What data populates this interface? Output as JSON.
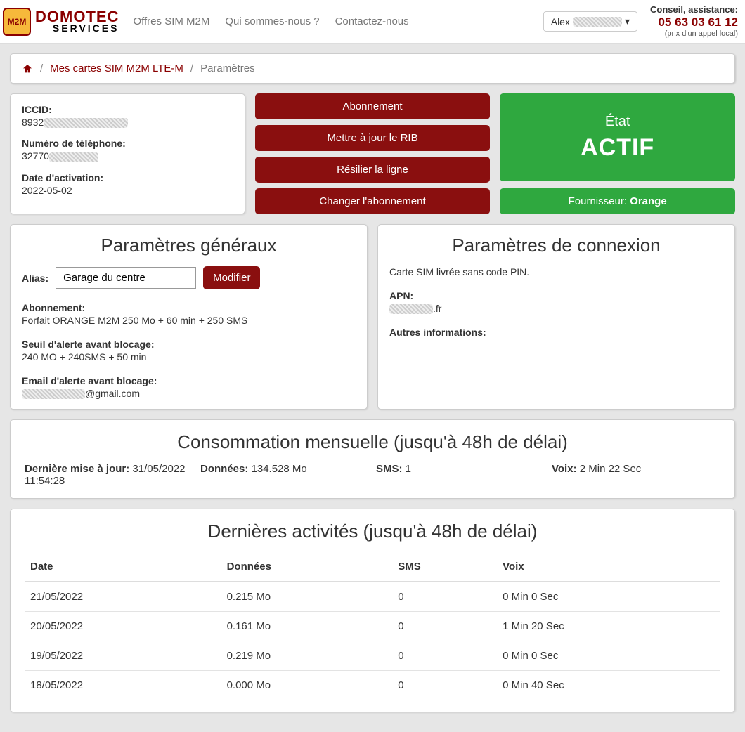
{
  "topbar": {
    "logo_chip": "M2M",
    "logo_line1": "DOMOTEC",
    "logo_line2": "SERVICES",
    "nav": [
      "Offres SIM M2M",
      "Qui sommes-nous ?",
      "Contactez-nous"
    ],
    "user_prefix": "Alex",
    "contact_l1": "Conseil, assistance:",
    "contact_l2": "05 63 03 61 12",
    "contact_l3": "(prix d'un appel local)"
  },
  "breadcrumb": {
    "link1": "Mes cartes SIM M2M LTE-M",
    "current": "Paramètres"
  },
  "info": {
    "iccid_label": "ICCID:",
    "iccid_value": "8932",
    "phone_label": "Numéro de téléphone:",
    "phone_value": "32770",
    "activation_label": "Date d'activation:",
    "activation_value": "2022-05-02"
  },
  "actions": {
    "b1": "Abonnement",
    "b2": "Mettre à jour le RIB",
    "b3": "Résilier la ligne",
    "b4": "Changer l'abonnement"
  },
  "state": {
    "title": "État",
    "value": "ACTIF",
    "provider_label": "Fournisseur: ",
    "provider_value": "Orange"
  },
  "general": {
    "title": "Paramètres généraux",
    "alias_label": "Alias:",
    "alias_value": "Garage du centre",
    "alias_btn": "Modifier",
    "subscription_label": "Abonnement:",
    "subscription_value": "Forfait ORANGE M2M 250 Mo + 60 min + 250 SMS",
    "threshold_label": "Seuil d'alerte avant blocage:",
    "threshold_value": "240 MO + 240SMS + 50 min",
    "email_label": "Email d'alerte avant blocage:",
    "email_value": "@gmail.com"
  },
  "connection": {
    "title": "Paramètres de connexion",
    "pin_note": "Carte SIM livrée sans code PIN.",
    "apn_label": "APN:",
    "apn_value": ".fr",
    "other_label": "Autres informations:"
  },
  "consumption": {
    "title": "Consommation mensuelle (jusqu'à 48h de délai)",
    "updated_label": "Dernière mise à jour: ",
    "updated_value": "31/05/2022 11:54:28",
    "data_label": "Données: ",
    "data_value": "134.528 Mo",
    "sms_label": "SMS: ",
    "sms_value": "1",
    "voice_label": "Voix: ",
    "voice_value": "2 Min 22 Sec"
  },
  "activities": {
    "title": "Dernières activités (jusqu'à 48h de délai)",
    "headers": {
      "date": "Date",
      "data": "Données",
      "sms": "SMS",
      "voice": "Voix"
    },
    "rows": [
      {
        "date": "21/05/2022",
        "data": "0.215 Mo",
        "sms": "0",
        "voice": "0 Min 0 Sec"
      },
      {
        "date": "20/05/2022",
        "data": "0.161 Mo",
        "sms": "0",
        "voice": "1 Min 20 Sec"
      },
      {
        "date": "19/05/2022",
        "data": "0.219 Mo",
        "sms": "0",
        "voice": "0 Min 0 Sec"
      },
      {
        "date": "18/05/2022",
        "data": "0.000 Mo",
        "sms": "0",
        "voice": "0 Min 40 Sec"
      }
    ]
  }
}
